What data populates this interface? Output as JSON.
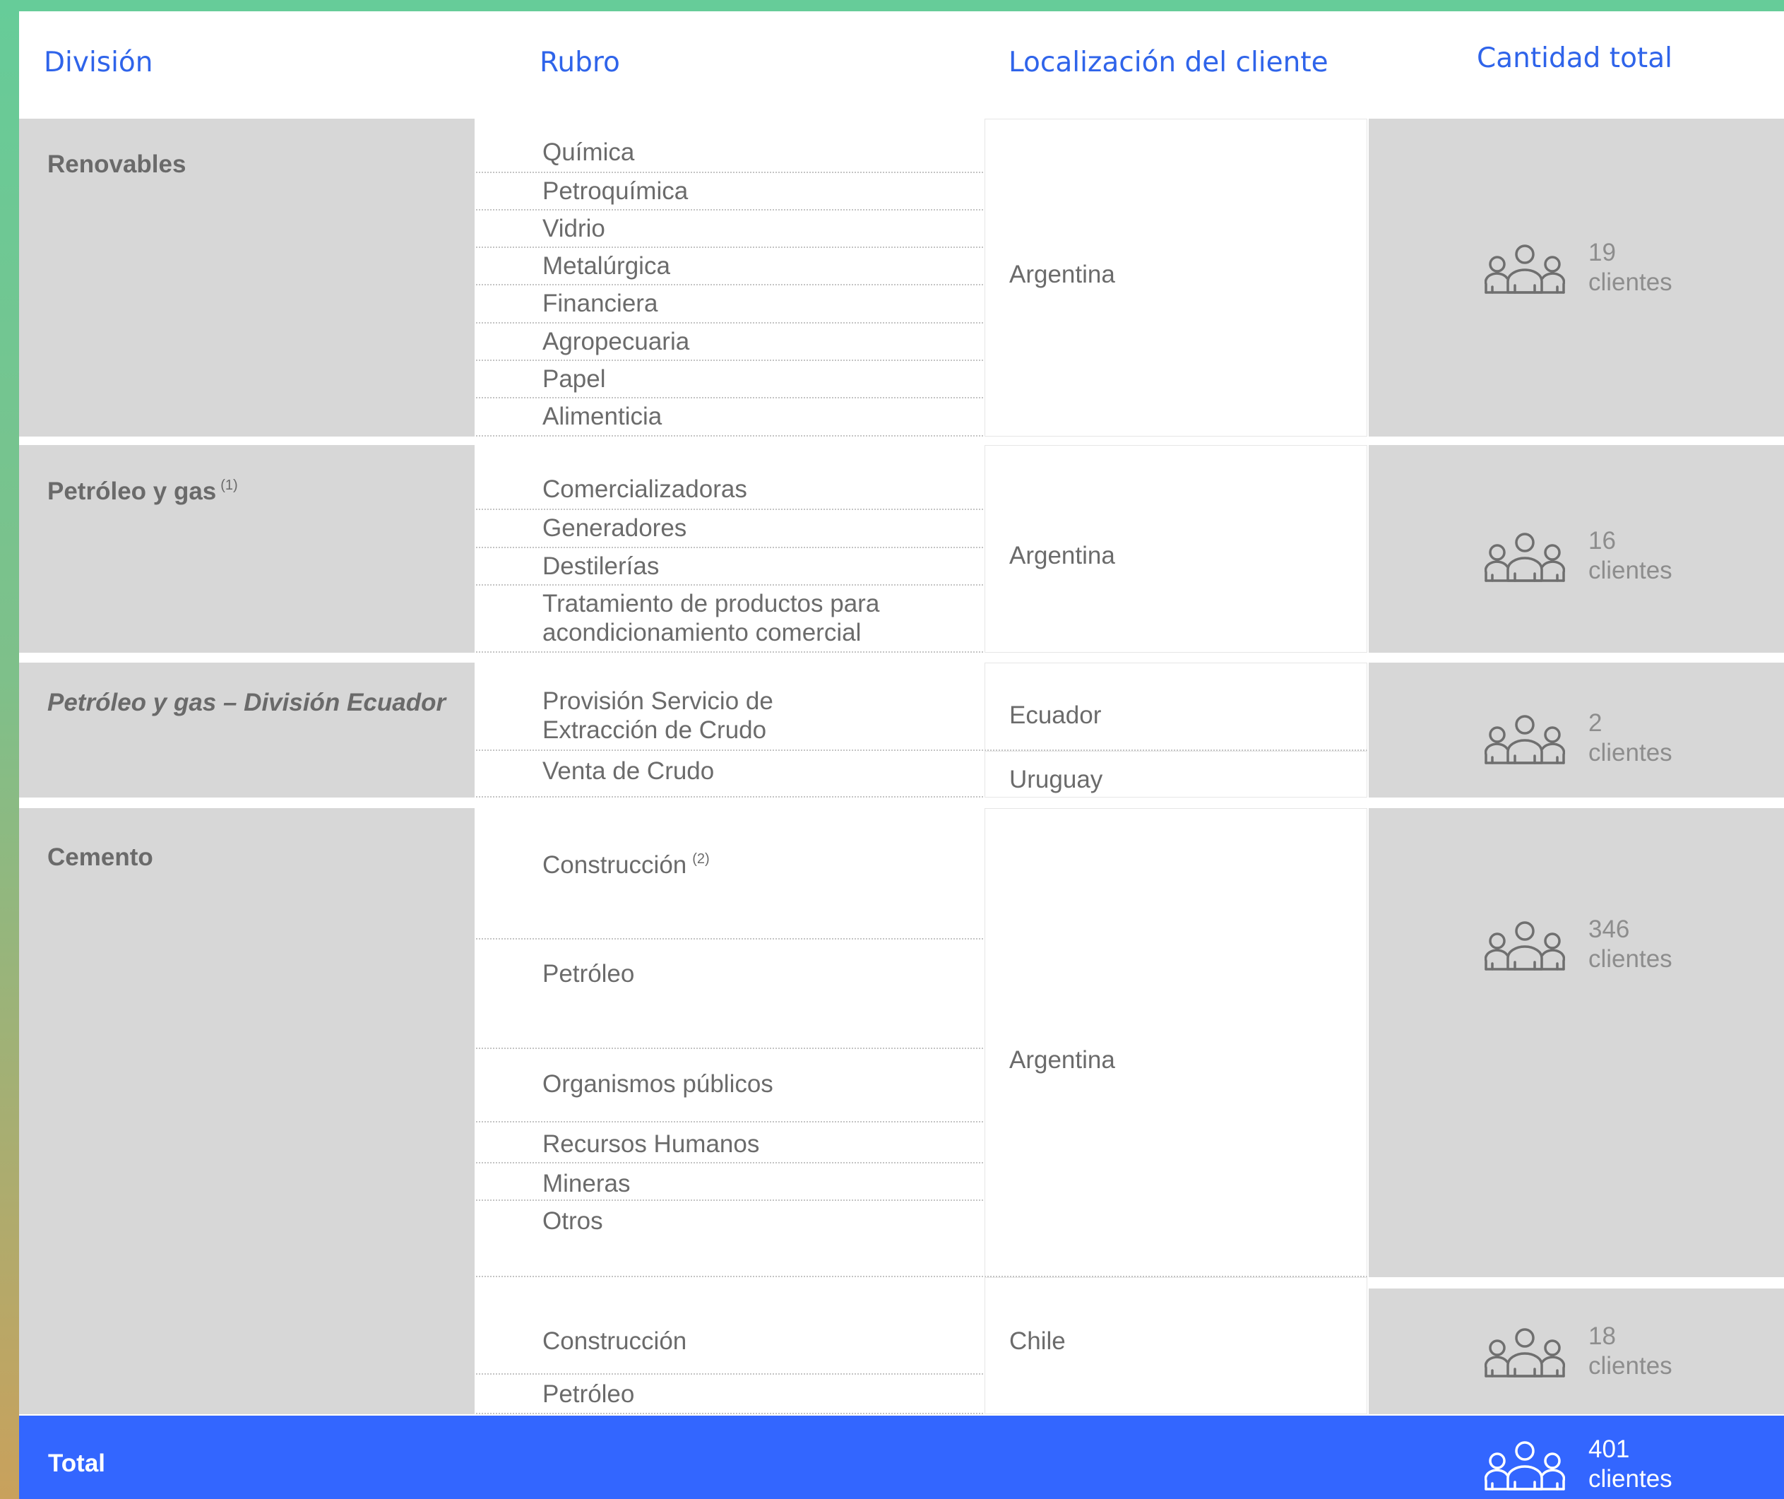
{
  "headers": {
    "division": "División",
    "rubro": "Rubro",
    "localizacion": "Localización del cliente",
    "cantidad": "Cantidad total"
  },
  "icon": "people-group-icon",
  "colors": {
    "header_text": "#2f64ea",
    "grey_fill": "#d7d7d7",
    "total_bar": "#3366ff",
    "frame_top": "#66cc99",
    "frame_bottom": "#c9a15c"
  },
  "groups": [
    {
      "division": "Renovables",
      "rubros": [
        "Química",
        "Petroquímica",
        "Vidrio",
        "Metalúrgica",
        "Financiera",
        "Agropecuaria",
        "Papel",
        "Alimenticia"
      ],
      "location": "Argentina",
      "count": "19",
      "count_label": "clientes"
    },
    {
      "division": "Petróleo y gas",
      "division_note": "(1)",
      "rubros": [
        "Comercializadoras",
        "Generadores",
        "Destilerías",
        "Tratamiento de productos para acondicionamiento comercial"
      ],
      "location": "Argentina",
      "count": "16",
      "count_label": "clientes"
    },
    {
      "division": "Petróleo y gas – División Ecuador",
      "rubros": [
        "Provisión Servicio de Extracción de Crudo",
        "Venta de Crudo"
      ],
      "locations": [
        "Ecuador",
        "Uruguay"
      ],
      "count": "2",
      "count_label": "clientes"
    },
    {
      "division": "Cemento",
      "rubros_argentina": [
        "Construcción",
        "Petróleo",
        "Organismos públicos",
        "Recursos Humanos",
        "Mineras",
        "Otros"
      ],
      "rubro_note": "(2)",
      "location_argentina": "Argentina",
      "count_argentina": "346",
      "rubros_chile": [
        "Construcción",
        "Petróleo"
      ],
      "location_chile": "Chile",
      "count_chile": "18",
      "count_label": "clientes"
    }
  ],
  "total": {
    "label": "Total",
    "count": "401",
    "count_label": "clientes"
  }
}
